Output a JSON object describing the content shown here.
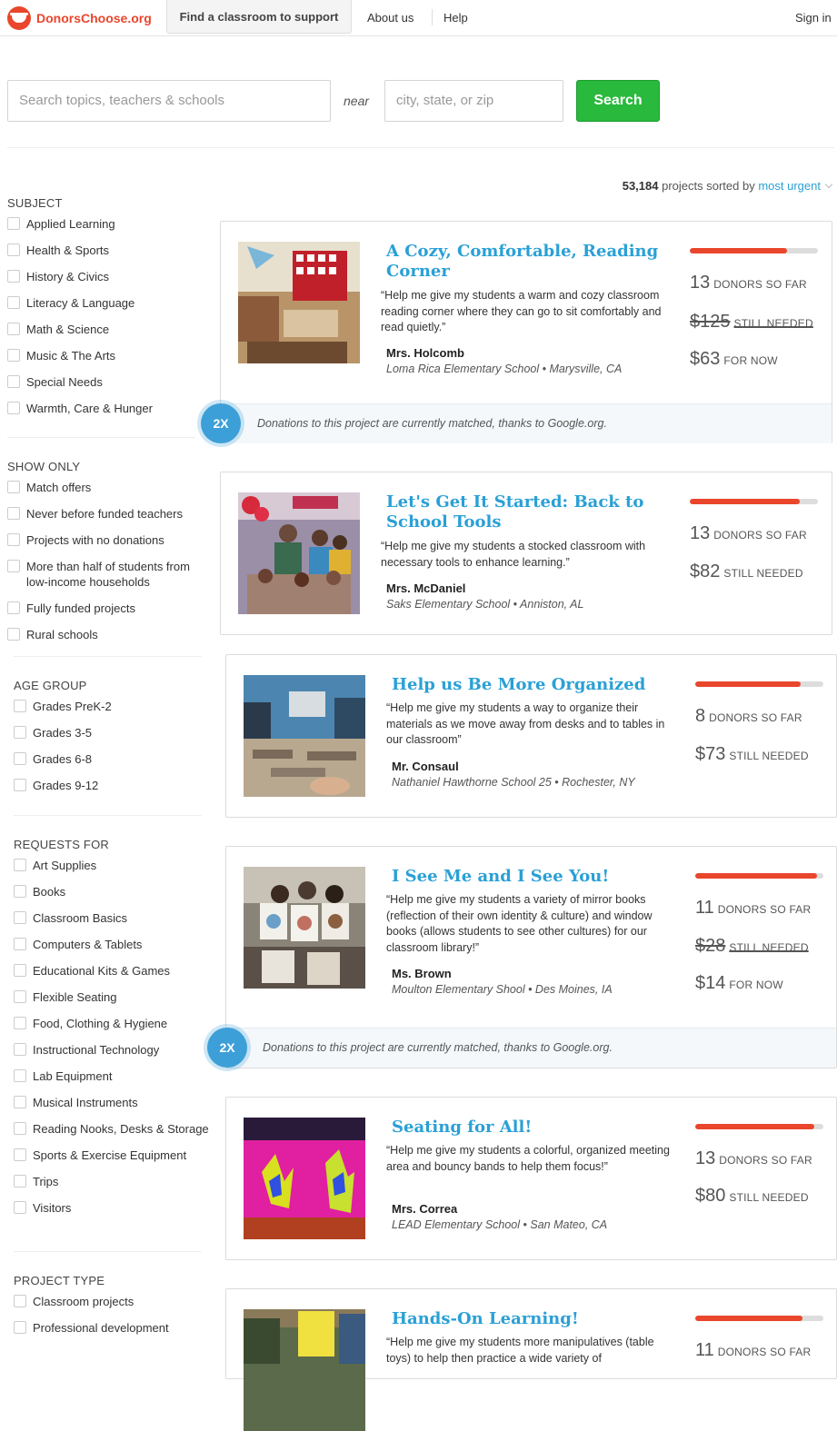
{
  "header": {
    "logo_text": "DonorsChoose.org",
    "nav_find": "Find a classroom to support",
    "nav_about": "About us",
    "nav_help": "Help",
    "sign_in": "Sign in"
  },
  "search": {
    "topic_placeholder": "Search topics, teachers & schools",
    "near_label": "near",
    "location_placeholder": "city, state, or zip",
    "button_label": "Search"
  },
  "results": {
    "count": "53,184",
    "sorted_text": "projects sorted by",
    "sort_value": "most urgent"
  },
  "filters": {
    "subject": {
      "title": "SUBJECT",
      "items": [
        "Applied Learning",
        "Health & Sports",
        "History & Civics",
        "Literacy & Language",
        "Math & Science",
        "Music & The Arts",
        "Special Needs",
        "Warmth, Care & Hunger"
      ]
    },
    "show_only": {
      "title": "SHOW ONLY",
      "items": [
        "Match offers",
        "Never before funded teachers",
        "Projects with no donations",
        "More than half of students from low-income households",
        "Fully funded projects",
        "Rural schools"
      ]
    },
    "age_group": {
      "title": "AGE GROUP",
      "items": [
        "Grades PreK-2",
        "Grades 3-5",
        "Grades 6-8",
        "Grades 9-12"
      ]
    },
    "requests_for": {
      "title": "REQUESTS FOR",
      "items": [
        "Art Supplies",
        "Books",
        "Classroom Basics",
        "Computers & Tablets",
        "Educational Kits & Games",
        "Flexible Seating",
        "Food, Clothing & Hygiene",
        "Instructional Technology",
        "Lab Equipment",
        "Musical Instruments",
        "Reading Nooks, Desks & Storage",
        "Sports & Exercise Equipment",
        "Trips",
        "Visitors"
      ]
    },
    "project_type": {
      "title": "PROJECT TYPE",
      "items": [
        "Classroom projects",
        "Professional development"
      ]
    }
  },
  "match_text": "Donations to this project are currently matched, thanks to Google.org.",
  "match_badge": "2X",
  "labels": {
    "donors": "DONORS SO FAR",
    "still_needed": "STILL NEEDED",
    "for_now": "FOR NOW"
  },
  "projects": [
    {
      "title": "A Cozy, Comfortable, Reading Corner",
      "quote": "“Help me give my students a warm and cozy classroom reading corner where they can go to sit comfortably and read quietly.”",
      "teacher": "Mrs. Holcomb",
      "school": "Loma Rica Elementary School • Marysville, CA",
      "progress_pct": 76,
      "donors": "13",
      "original_needed": "$125",
      "needed": "$63",
      "matched": true
    },
    {
      "title": "Let's Get It Started: Back to School Tools",
      "quote": "“Help me give my students a stocked classroom with necessary tools to enhance learning.”",
      "teacher": "Mrs. McDaniel",
      "school": "Saks Elementary School • Anniston, AL",
      "progress_pct": 86,
      "donors": "13",
      "needed": "$82",
      "matched": false
    },
    {
      "title": "Help us Be More Organized",
      "quote": "“Help me give my students a way to organize their materials as we move away from desks and to tables in our classroom”",
      "teacher": "Mr. Consaul",
      "school": "Nathaniel Hawthorne School 25 • Rochester, NY",
      "progress_pct": 82,
      "donors": "8",
      "needed": "$73",
      "matched": false
    },
    {
      "title": "I See Me and I See You!",
      "quote": "“Help me give my students a variety of mirror books (reflection of their own identity & culture) and window books (allows students to see other cultures) for our classroom library!”",
      "teacher": "Ms. Brown",
      "school": "Moulton Elementary Shool • Des Moines, IA",
      "progress_pct": 95,
      "donors": "11",
      "original_needed": "$28",
      "needed": "$14",
      "matched": true
    },
    {
      "title": "Seating for All!",
      "quote": "“Help me give my students a colorful, organized meeting area and bouncy bands to help them focus!”",
      "teacher": "Mrs. Correa",
      "school": "LEAD Elementary School • San Mateo, CA",
      "progress_pct": 93,
      "donors": "13",
      "needed": "$80",
      "matched": false
    },
    {
      "title": "Hands-On Learning!",
      "quote": "“Help me give my students more manipulatives (table toys) to help then practice a wide variety of",
      "progress_pct": 84,
      "donors": "11",
      "matched": false
    }
  ]
}
